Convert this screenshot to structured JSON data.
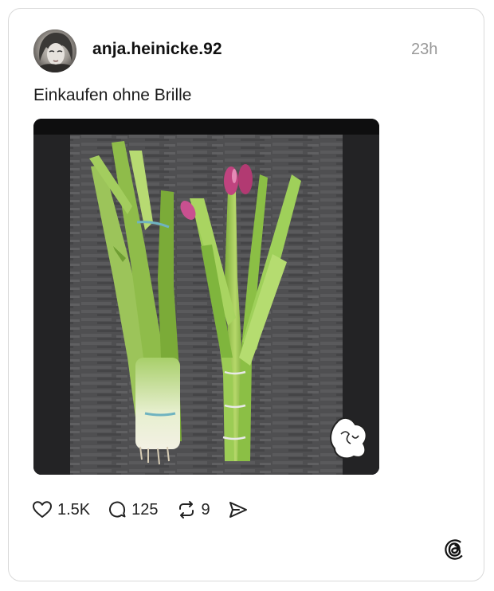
{
  "post": {
    "username": "anja.heinicke.92",
    "timestamp": "23h",
    "caption": "Einkaufen ohne Brille",
    "avatar_icon": "profile-photo",
    "media_icon": "photo-leeks-and-tulips"
  },
  "actions": {
    "likes": "1.5K",
    "replies": "125",
    "reposts": "9",
    "like_icon": "heart-icon",
    "reply_icon": "comment-icon",
    "repost_icon": "repost-icon",
    "share_icon": "send-icon"
  },
  "brand": {
    "logo": "threads-logo",
    "accent": "#111111"
  }
}
